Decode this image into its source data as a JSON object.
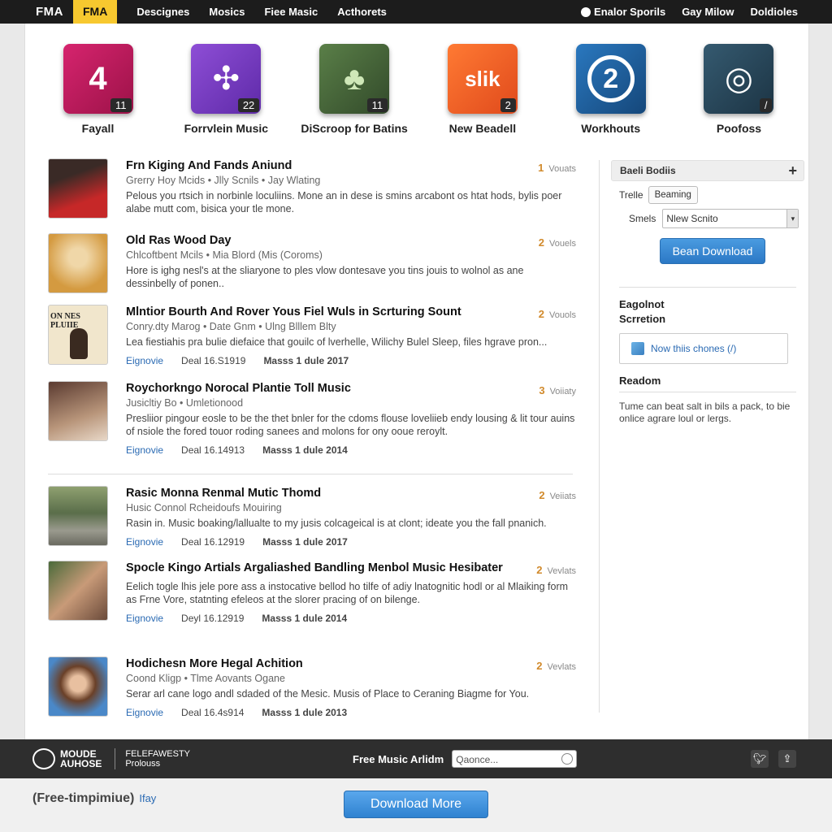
{
  "nav": {
    "logo": "FMA",
    "logo_box": "FMA",
    "left": [
      "Descignes",
      "Mosics",
      "Fiee Masic",
      "Acthorets"
    ],
    "right": [
      "Enalor Sporils",
      "Gay Milow",
      "Doldioles"
    ],
    "right_icon": "user-icon"
  },
  "tiles": [
    {
      "label": "Fayall",
      "badge": "11",
      "glyph": "4",
      "color": "#c2185b"
    },
    {
      "label": "Forrvlein Music",
      "badge": "22",
      "glyph": "✣",
      "color": "#7b3fc0"
    },
    {
      "label": "DiScroop for Batins",
      "badge": "11",
      "glyph": "♣",
      "color": "#4a6b3c"
    },
    {
      "label": "New Beadell",
      "badge": "2",
      "glyph": "slik",
      "color": "#f05a28"
    },
    {
      "label": "Workhouts",
      "badge": "",
      "glyph": "2",
      "color": "#1e5f9c"
    },
    {
      "label": "Poofoss",
      "badge": "/",
      "glyph": "◎",
      "color": "#2b4a5e"
    }
  ],
  "feed": [
    {
      "title": "Frn Kiging And Fands Aniund",
      "meta": "Grerry Hoy Mcids  •  Jlly Scnils  •  Jay Wlating",
      "desc": "Pelous you rtsich in norbinle loculiins. Mone an in dese is smins arcabont os htat hods, bylis poer alabe mutt com, bisica your tle mone.",
      "foot": null,
      "votes_n": "1",
      "votes_label": "Vouats",
      "thumb": "#b22"
    },
    {
      "title": "Old Ras Wood Day",
      "meta": "Chlcoftbent Mcils  •  Mia Blord (Mis (Coroms)",
      "desc": "Hore is ighg nesl's at the sliaryone to ples vlow dontesave you tins jouis to wolnol as ane dessinbelly of ponen..",
      "foot": null,
      "votes_n": "2",
      "votes_label": "Vouels",
      "thumb": "#d4a054"
    },
    {
      "title": "Mlntior Bourth And Rover Yous Fiel Wuls in Scrturing Sount",
      "meta": "Conry.dty Marog  •  Date Gnm  •  Ulng Blllem Blty",
      "desc": "Lea fiestiahis pra bulie diefaice that gouilc of lverhelle, Wilichy Bulel Sleep, files hgrave pron...",
      "foot": [
        "Eignovie",
        "Deal 16.S1919",
        "Masss 1 dule 2017"
      ],
      "votes_n": "2",
      "votes_label": "Vouols",
      "thumb": "#e8dcc0",
      "thumb_text": "ON NES PLUIIE"
    },
    {
      "title": "Roychorkngo Norocal Plantie Toll Music",
      "meta": "Jusicltiy Bo  •  Umletionood",
      "desc": "Presliior pingour eosle to be the thet bnler for the cdoms flouse loveliieb endy lousing & lit tour auins of nsiole the fored touor roding sanees and molons for ony ooue reroylt.",
      "foot": [
        "Eignovie",
        "Deal 16.14913",
        "Masss 1 dule 2014"
      ],
      "votes_n": "3",
      "votes_label": "Voiiaty",
      "thumb": "#8a6a5a"
    },
    {
      "title": "Rasic Monna Renmal Mutic Thomd",
      "meta": "Husic Connol Rcheidoufs  Mouiring",
      "desc": "Rasin in. Music boaking/lallualte to my jusis colcageical is at clont; ideate you the fall pnanich.",
      "foot": [
        "Eignovie",
        "Deal 16.12919",
        "Masss 1 dule 2017"
      ],
      "votes_n": "2",
      "votes_label": "Veiiats",
      "thumb": "#6d7f5a"
    },
    {
      "title": "Spocle Kingo Artials Argaliashed Bandling Menbol Music Hesibater",
      "meta": "",
      "desc": "Eelich togle lhis jele pore ass a instocative bellod ho tilfe of adiy lnatognitic hodl or al Mlaiking form as Frne Vore, statnting efeleos at the slorer pracing of on bilenge.",
      "foot": [
        "Eignovie",
        "Deyl 16.12919",
        "Masss 1 dule 2014"
      ],
      "votes_n": "2",
      "votes_label": "Vevlats",
      "thumb": "#7a5a48"
    },
    {
      "title": "Hodichesn More Hegal Achition",
      "meta": "Coond Kligp  •  Tlme Aovants Ogane",
      "desc": "Serar arl cane logo andl sdaded of the Mesic. Musis of Place to Ceraning Biagme for You.",
      "foot": [
        "Eignovie",
        "Deal 16.4s914",
        "Masss 1 dule 2013"
      ],
      "votes_n": "2",
      "votes_label": "Vevlats",
      "thumb": "#3a6fa0"
    }
  ],
  "sidebar": {
    "head": "Baeli Bodiis",
    "row1_label": "Trelle",
    "row1_tag": "Beaming",
    "row2_label": "Smels",
    "row2_value": "Nlew Scnito",
    "button": "Bean Download",
    "section_title_1": "Eagolnot",
    "section_title_2": "Scrretion",
    "box_link": "Now thiis chones (/)",
    "section3_title": "Readom",
    "section3_text": "Tume can beat salt in bils a pack, to bie onlice agrare loul or lergs."
  },
  "footer": {
    "logo_line1": "MOUDE",
    "logo_line2": "AUHOSE",
    "sub_line1": "FELEFAWESTY",
    "sub_line2": "Prolouss",
    "label": "Free Music Arlidm",
    "search_placeholder": "Qaonce...",
    "social": [
      "twitter-icon",
      "share-icon"
    ]
  },
  "bottom": {
    "text": "(Free-timpimiue)",
    "small": "Ifay",
    "button": "Download More"
  }
}
